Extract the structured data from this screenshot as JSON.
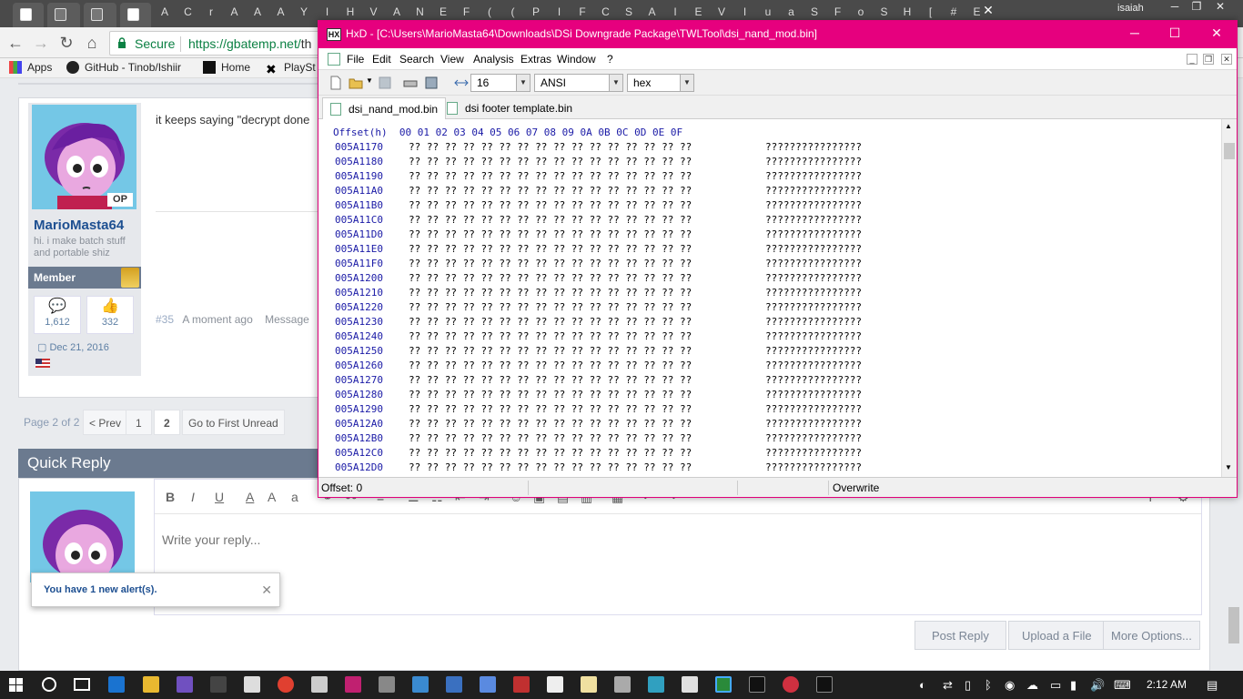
{
  "browser": {
    "tab_letters": [
      "A",
      "C",
      "r",
      "A",
      "A",
      "A",
      "Y",
      "I",
      "H",
      "V",
      "A",
      "N",
      "E",
      "F",
      "(",
      "(",
      "P",
      "I",
      "F",
      "C",
      "S",
      "A",
      "I",
      "E",
      "V",
      "I",
      "u",
      "a",
      "S",
      "F",
      "o",
      "S",
      "H",
      "[",
      "#",
      "E"
    ],
    "user_name": "isaiah",
    "secure_label": "Secure",
    "url_host": "https://gbatemp.net/",
    "url_rest": "th",
    "bookmarks": [
      "Apps",
      "GitHub - Tinob/Ishiir",
      "Home",
      "PlaySt"
    ]
  },
  "post": {
    "text": "it keeps saying \"decrypt done",
    "username": "MarioMasta64",
    "user_title": "hi. i make batch stuff and portable shiz",
    "op_badge": "OP",
    "rank": "Member",
    "messages": "1,612",
    "likes": "332",
    "join_date": "Dec 21, 2016",
    "post_number": "#35",
    "time": "A moment ago",
    "message_link": "Message"
  },
  "pagination": {
    "page_label": "Page 2 of 2",
    "prev": "< Prev",
    "p1": "1",
    "p2": "2",
    "first_unread": "Go to First Unread"
  },
  "quick_reply": {
    "title": "Quick Reply",
    "placeholder": "Write your reply...",
    "post_reply": "Post Reply",
    "upload": "Upload a File",
    "more": "More Options..."
  },
  "alert": {
    "text": "You have 1 new alert(s)."
  },
  "hxd": {
    "title": "HxD - [C:\\Users\\MarioMasta64\\Downloads\\DSi Downgrade Package\\TWLTool\\dsi_nand_mod.bin]",
    "menus": [
      "File",
      "Edit",
      "Search",
      "View",
      "Analysis",
      "Extras",
      "Window",
      "?"
    ],
    "bytes_per_row": "16",
    "charset": "ANSI",
    "mode": "hex",
    "tabs": [
      "dsi_nand_mod.bin",
      "dsi footer template.bin"
    ],
    "header": "Offset(h)  00 01 02 03 04 05 06 07 08 09 0A 0B 0C 0D 0E 0F",
    "byte_text": "?? ?? ?? ?? ?? ?? ?? ?? ?? ?? ?? ?? ?? ?? ?? ??",
    "ascii_text": "????????????????",
    "rows": [
      "005A1170",
      "005A1180",
      "005A1190",
      "005A11A0",
      "005A11B0",
      "005A11C0",
      "005A11D0",
      "005A11E0",
      "005A11F0",
      "005A1200",
      "005A1210",
      "005A1220",
      "005A1230",
      "005A1240",
      "005A1250",
      "005A1260",
      "005A1270",
      "005A1280",
      "005A1290",
      "005A12A0",
      "005A12B0",
      "005A12C0",
      "005A12D0"
    ],
    "status_offset": "Offset: 0",
    "status_mode": "Overwrite"
  },
  "taskbar": {
    "clock": "2:12 AM"
  }
}
